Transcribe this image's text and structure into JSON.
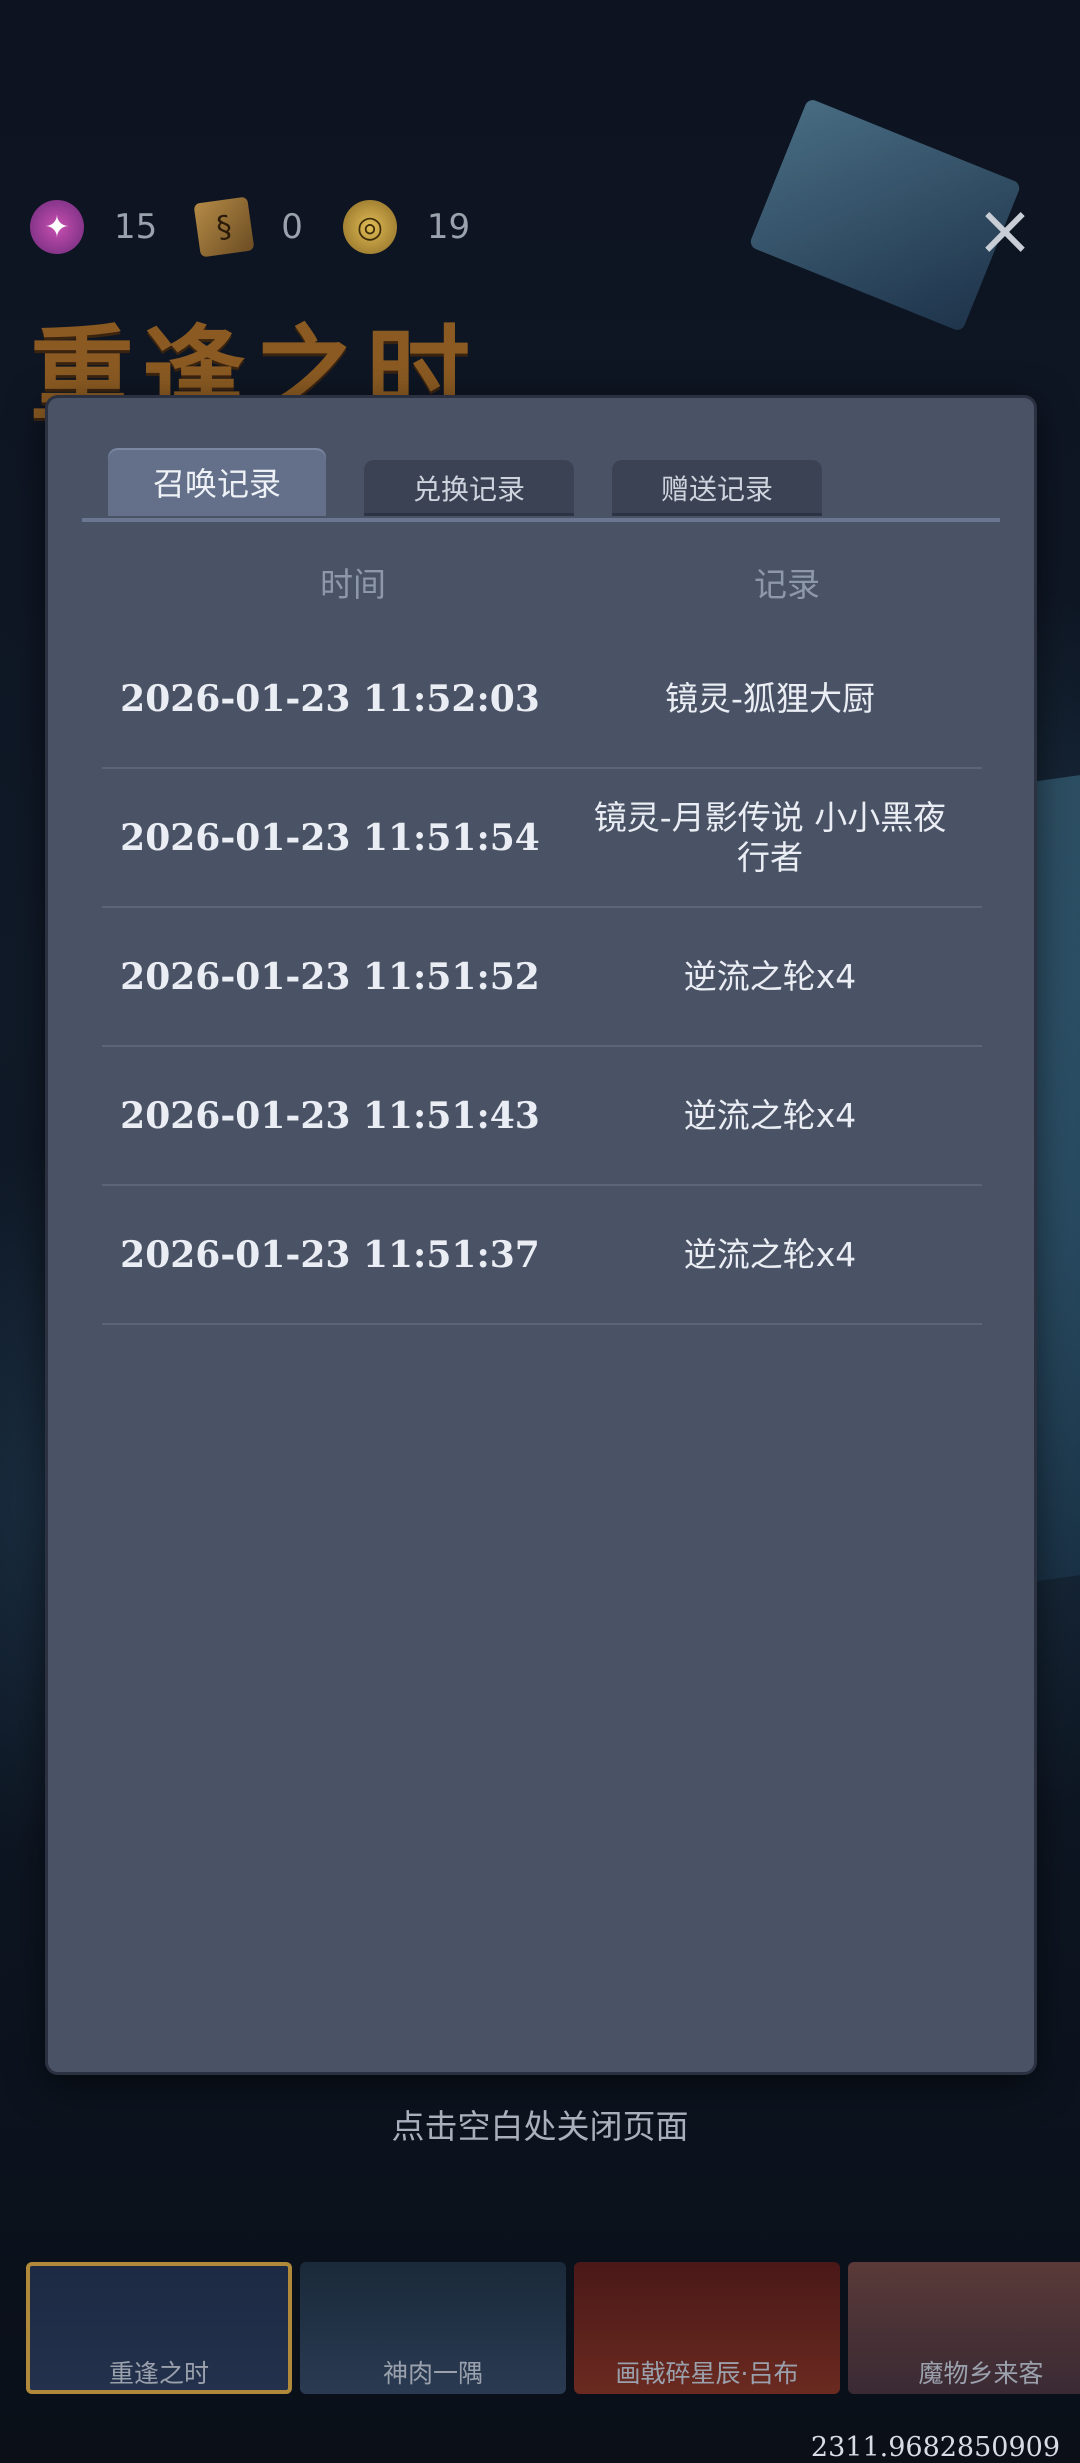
{
  "currencies": [
    {
      "icon": "candy-icon",
      "glyph": "✦",
      "value": "15"
    },
    {
      "icon": "book-icon",
      "glyph": "§",
      "value": "0"
    },
    {
      "icon": "coin-icon",
      "glyph": "◎",
      "value": "19"
    }
  ],
  "event_title": "重逢之时",
  "tabs": [
    {
      "label": "召唤记录",
      "active": true
    },
    {
      "label": "兑换记录",
      "active": false
    },
    {
      "label": "赠送记录",
      "active": false
    }
  ],
  "columns": {
    "time": "时间",
    "record": "记录"
  },
  "records": [
    {
      "time": "2026-01-23  11:52:03",
      "record": "镜灵-狐狸大厨"
    },
    {
      "time": "2026-01-23  11:51:54",
      "record": "镜灵-月影传说 小小黑夜行者"
    },
    {
      "time": "2026-01-23  11:51:52",
      "record": "逆流之轮x4"
    },
    {
      "time": "2026-01-23  11:51:43",
      "record": "逆流之轮x4"
    },
    {
      "time": "2026-01-23  11:51:37",
      "record": "逆流之轮x4"
    }
  ],
  "close_hint": "点击空白处关闭页面",
  "banners": [
    {
      "label": "重逢之时"
    },
    {
      "label": "神肉一隅"
    },
    {
      "label": "画戟碎星辰·吕布"
    },
    {
      "label": "魔物乡来客"
    }
  ],
  "footer_value": "2311.9682850909",
  "colors": {
    "modal_bg": "#4a5265",
    "active_tab": "#64708a",
    "title_gold": "#8a5a22"
  }
}
